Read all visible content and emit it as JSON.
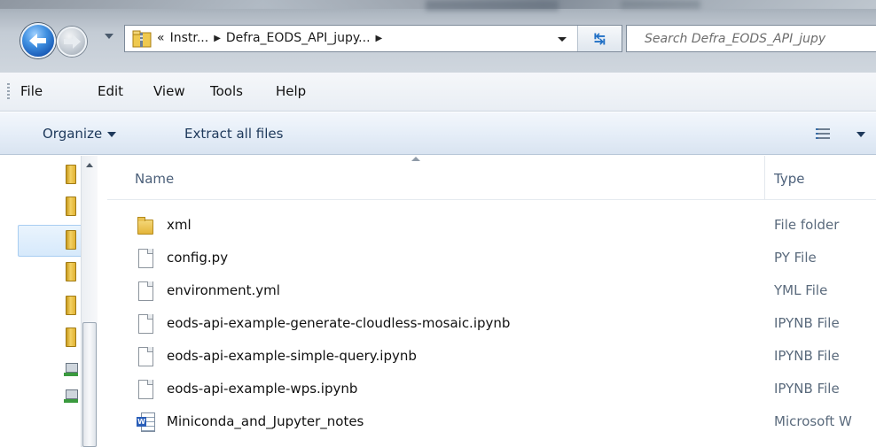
{
  "address": {
    "overflow": "«",
    "crumbs": [
      "Instr...",
      "Defra_EODS_API_jupy..."
    ]
  },
  "search": {
    "placeholder": "Search Defra_EODS_API_jupy"
  },
  "menu": [
    "File",
    "Edit",
    "View",
    "Tools",
    "Help"
  ],
  "commandbar": {
    "organize": "Organize",
    "extract": "Extract all files"
  },
  "columns": {
    "name": "Name",
    "type": "Type"
  },
  "files": [
    {
      "name": "xml",
      "type": "File folder",
      "icon": "folder-icon"
    },
    {
      "name": "config.py",
      "type": "PY File",
      "icon": "file-icon"
    },
    {
      "name": "environment.yml",
      "type": "YML File",
      "icon": "file-icon"
    },
    {
      "name": "eods-api-example-generate-cloudless-mosaic.ipynb",
      "type": "IPYNB File",
      "icon": "file-icon"
    },
    {
      "name": "eods-api-example-simple-query.ipynb",
      "type": "IPYNB File",
      "icon": "file-icon"
    },
    {
      "name": "eods-api-example-wps.ipynb",
      "type": "IPYNB File",
      "icon": "file-icon"
    },
    {
      "name": "Miniconda_and_Jupyter_notes",
      "type": "Microsoft W",
      "icon": "word-document-icon"
    }
  ],
  "colors": {
    "accent": "#1e395b",
    "selection": "#d6e9fb",
    "folder": "#e4b53a"
  }
}
